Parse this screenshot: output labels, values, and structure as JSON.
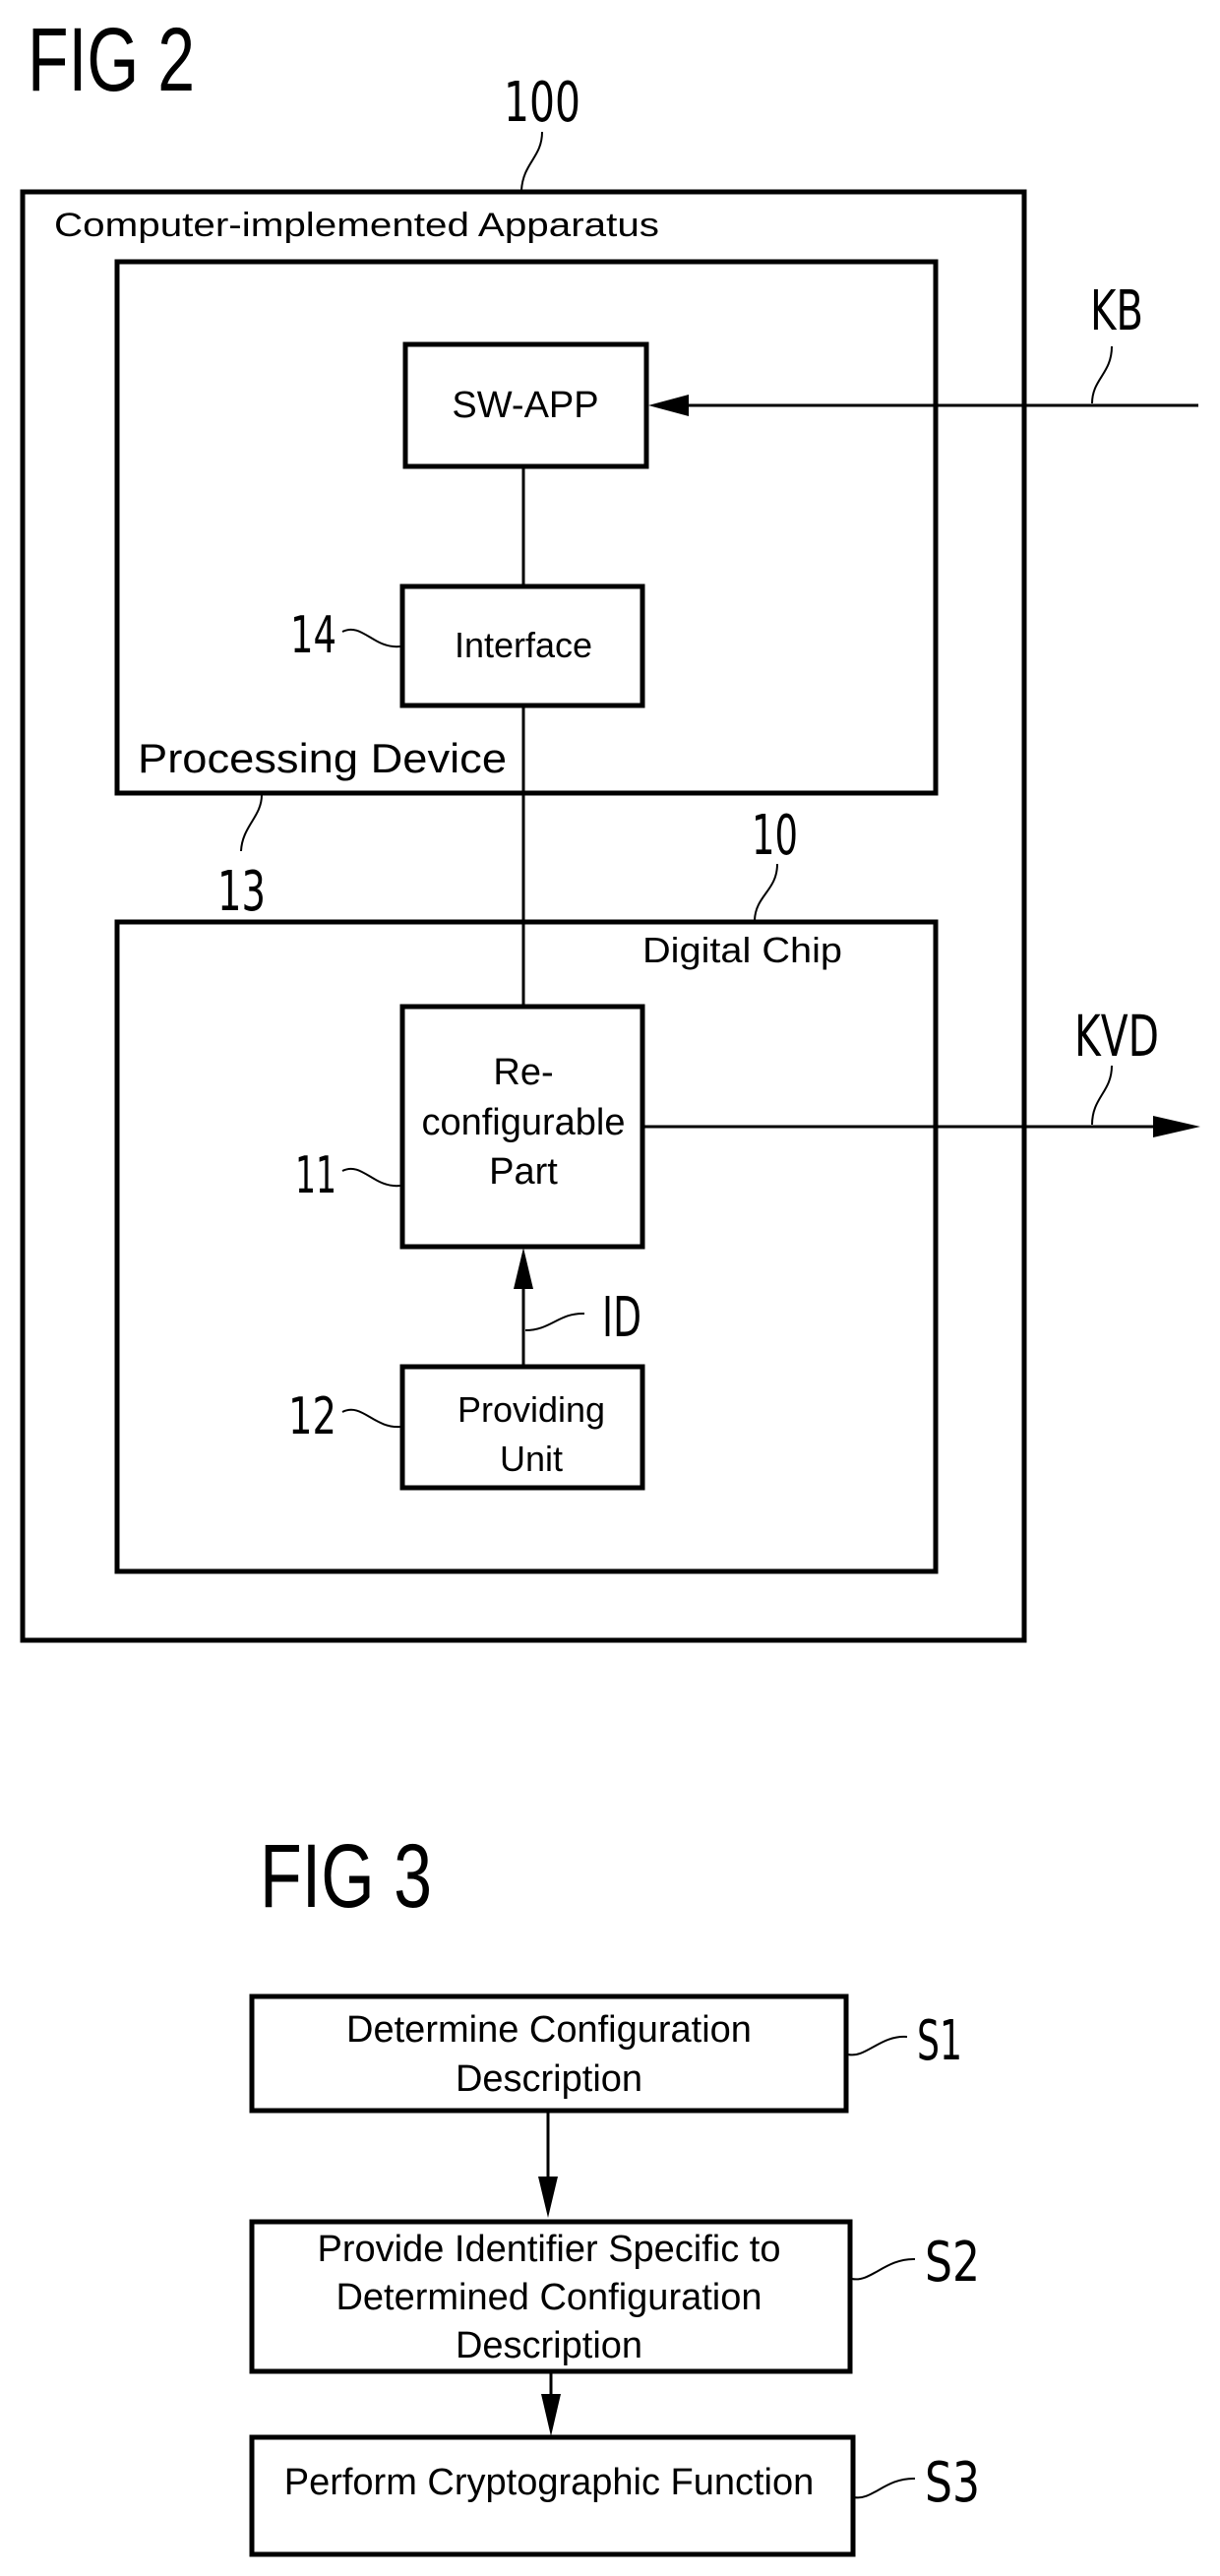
{
  "figures": {
    "fig2": {
      "title": "FIG 2",
      "apparatus": {
        "ref": "100",
        "label": "Computer-implemented Apparatus"
      },
      "processing_device": {
        "ref": "13",
        "label": "Processing Device"
      },
      "sw_app": {
        "label": "SW-APP"
      },
      "interface": {
        "ref": "14",
        "label": "Interface"
      },
      "digital_chip": {
        "ref": "10",
        "label": "Digital Chip"
      },
      "reconfigurable_part": {
        "ref": "11",
        "lines": [
          "Re-",
          "configurable",
          "Part"
        ]
      },
      "providing_unit": {
        "ref": "12",
        "lines": [
          "Providing",
          "Unit"
        ]
      },
      "signals": {
        "input": "KB",
        "output": "KVD",
        "identifier": "ID"
      }
    },
    "fig3": {
      "title": "FIG 3",
      "steps": [
        {
          "id": "S1",
          "lines": [
            "Determine Configuration",
            "Description"
          ]
        },
        {
          "id": "S2",
          "lines": [
            "Provide Identifier Specific to",
            "Determined Configuration",
            "Description"
          ]
        },
        {
          "id": "S3",
          "lines": [
            "Perform Cryptographic Function"
          ]
        }
      ]
    }
  }
}
